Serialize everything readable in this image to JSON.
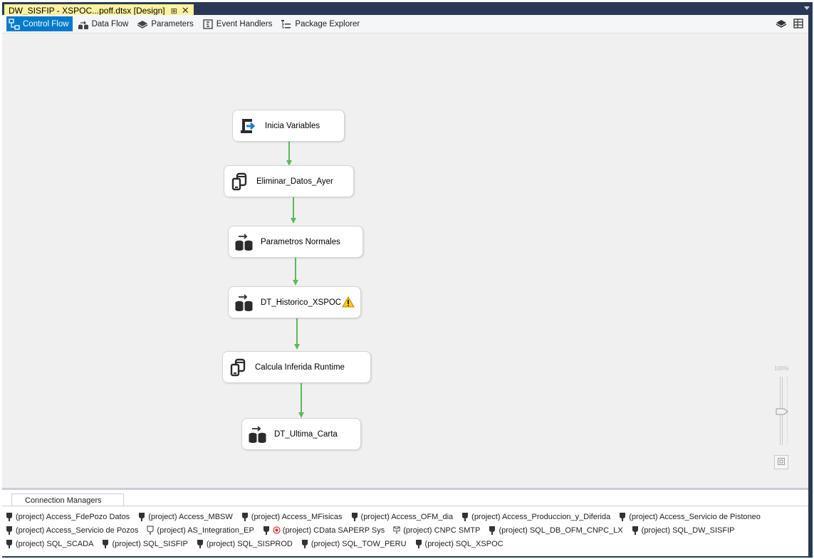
{
  "document_tab": {
    "title": "DW_SISFIP - XSPOC...poff.dtsx [Design]",
    "pin_icon": "pin-icon",
    "close_icon": "close-icon",
    "color": "#fff29d"
  },
  "designer_tabs": [
    {
      "label": "Control Flow",
      "icon": "control-flow-icon",
      "active": true
    },
    {
      "label": "Data Flow",
      "icon": "data-flow-icon",
      "active": false
    },
    {
      "label": "Parameters",
      "icon": "parameters-icon",
      "active": false
    },
    {
      "label": "Event Handlers",
      "icon": "event-handlers-icon",
      "active": false
    },
    {
      "label": "Package Explorer",
      "icon": "package-explorer-icon",
      "active": false
    }
  ],
  "toolbar_right_icons": [
    "variables-icon",
    "grid-icon"
  ],
  "tasks": [
    {
      "label": "Inicia Variables",
      "icon": "script-task-icon"
    },
    {
      "label": "Eliminar_Datos_Ayer",
      "icon": "execute-sql-task-icon"
    },
    {
      "label": "Parametros Normales",
      "icon": "data-flow-task-icon"
    },
    {
      "label": "DT_Historico_XSPOC",
      "icon": "data-flow-task-icon",
      "warning": true
    },
    {
      "label": "Calcula Inferida Runtime",
      "icon": "execute-sql-task-icon"
    },
    {
      "label": "DT_Ultima_Carta",
      "icon": "data-flow-task-icon"
    }
  ],
  "precedence_color": "#5cb85c",
  "zoom": {
    "label": "100%"
  },
  "connection_managers": {
    "tab_label": "Connection Managers",
    "items": [
      {
        "label": "(project) Access_FdePozo Datos",
        "icon": "connection-icon"
      },
      {
        "label": "(project) Access_MBSW",
        "icon": "connection-icon"
      },
      {
        "label": "(project) Access_MFisicas",
        "icon": "connection-icon"
      },
      {
        "label": "(project) Access_OFM_dia",
        "icon": "connection-icon"
      },
      {
        "label": "(project) Access_Produccion_y_Diferida",
        "icon": "connection-icon"
      },
      {
        "label": "(project) Access_Servicio de Pistoneo",
        "icon": "connection-icon"
      },
      {
        "label": "(project) Access_Servicio de Pozos",
        "icon": "connection-icon"
      },
      {
        "label": "(project) AS_Integration_EP",
        "icon": "analysis-services-connection-icon"
      },
      {
        "label": "(project) CData SAPERP Sys",
        "icon": "connection-icon",
        "error": true
      },
      {
        "label": "(project) CNPC SMTP",
        "icon": "smtp-connection-icon"
      },
      {
        "label": "(project) SQL_DB_OFM_CNPC_LX",
        "icon": "connection-icon"
      },
      {
        "label": "(project) SQL_DW_SISFIP",
        "icon": "connection-icon"
      },
      {
        "label": "(project) SQL_SCADA",
        "icon": "connection-icon"
      },
      {
        "label": "(project) SQL_SISFIP",
        "icon": "connection-icon"
      },
      {
        "label": "(project) SQL_SISPROD",
        "icon": "connection-icon"
      },
      {
        "label": "(project) SQL_TOW_PERU",
        "icon": "connection-icon"
      },
      {
        "label": "(project) SQL_XSPOC",
        "icon": "connection-icon"
      }
    ]
  }
}
